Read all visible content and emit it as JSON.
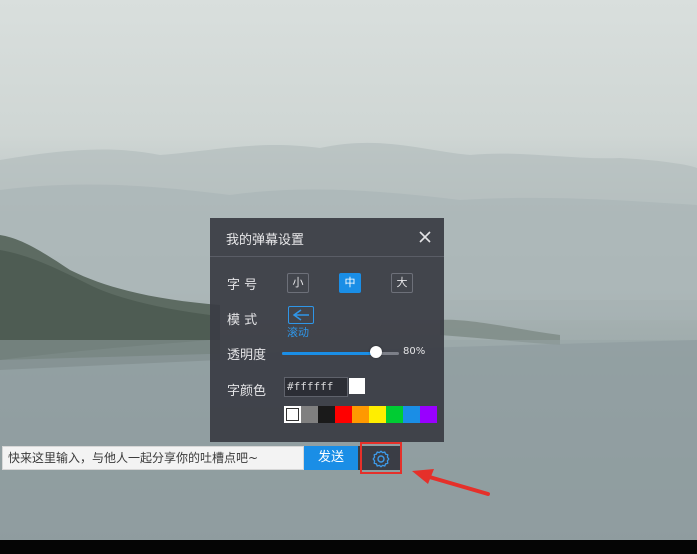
{
  "panel": {
    "title": "我的弹幕设置",
    "font_size": {
      "label": "字 号",
      "options": [
        {
          "label": "小",
          "active": false
        },
        {
          "label": "中",
          "active": true
        },
        {
          "label": "大",
          "active": false
        }
      ]
    },
    "mode": {
      "label": "模 式",
      "option_label": "滚动",
      "icon": "scroll-left-arrow-icon"
    },
    "opacity": {
      "label": "透明度",
      "value_text": "80%",
      "value": 0.8
    },
    "font_color": {
      "label": "字颜色",
      "hex_value": "#ffffff",
      "swatches": [
        "#ffffff",
        "#808080",
        "#1a1a1a",
        "#ff0000",
        "#ff9900",
        "#ffee00",
        "#00cc33",
        "#1a8ee6",
        "#9900ff"
      ],
      "selected_index": 0
    }
  },
  "danmaku_input": {
    "placeholder": "快来这里输入，与他人一起分享你的吐槽点吧~",
    "send_label": "发送"
  },
  "colors": {
    "accent": "#1a8ee6",
    "highlight": "#e5302a"
  }
}
